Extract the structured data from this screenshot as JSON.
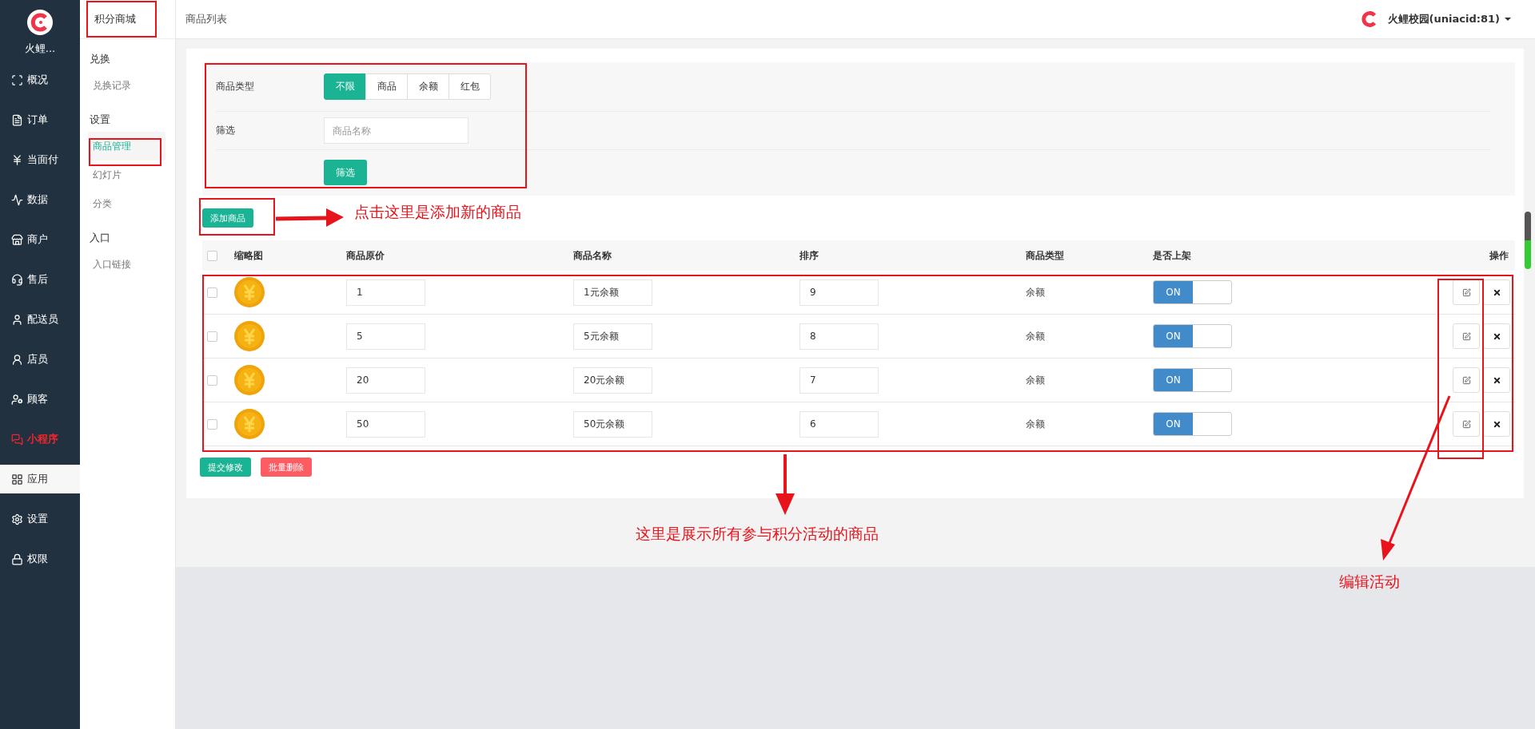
{
  "brand": {
    "name": "火鲤..."
  },
  "nav": [
    {
      "label": "概况",
      "selected": false,
      "highlight": false
    },
    {
      "label": "订单",
      "selected": false,
      "highlight": false
    },
    {
      "label": "当面付",
      "selected": false,
      "highlight": false
    },
    {
      "label": "数据",
      "selected": false,
      "highlight": false
    },
    {
      "label": "商户",
      "selected": false,
      "highlight": false
    },
    {
      "label": "售后",
      "selected": false,
      "highlight": false
    },
    {
      "label": "配送员",
      "selected": false,
      "highlight": false
    },
    {
      "label": "店员",
      "selected": false,
      "highlight": false
    },
    {
      "label": "顾客",
      "selected": false,
      "highlight": false
    },
    {
      "label": "小程序",
      "selected": false,
      "highlight": true
    },
    {
      "label": "应用",
      "selected": true,
      "highlight": false
    },
    {
      "label": "设置",
      "selected": false,
      "highlight": false
    },
    {
      "label": "权限",
      "selected": false,
      "highlight": false
    }
  ],
  "subnav": {
    "title": "积分商城",
    "groups": [
      {
        "label": "兑换",
        "items": [
          {
            "label": "兑换记录",
            "selected": false
          }
        ]
      },
      {
        "label": "设置",
        "items": [
          {
            "label": "商品管理",
            "selected": true
          },
          {
            "label": "幻灯片",
            "selected": false
          },
          {
            "label": "分类",
            "selected": false
          }
        ]
      },
      {
        "label": "入口",
        "items": [
          {
            "label": "入口链接",
            "selected": false
          }
        ]
      }
    ]
  },
  "header": {
    "title": "商品列表",
    "account": "火鲤校园(uniacid:81)"
  },
  "filter": {
    "type_label": "商品类型",
    "types": [
      {
        "label": "不限",
        "selected": true
      },
      {
        "label": "商品",
        "selected": false
      },
      {
        "label": "余额",
        "selected": false
      },
      {
        "label": "红包",
        "selected": false
      }
    ],
    "search_label": "筛选",
    "search_placeholder": "商品名称",
    "submit": "筛选"
  },
  "add_button": "添加商品",
  "table": {
    "all_checked": false,
    "columns": [
      "缩略图",
      "商品原价",
      "商品名称",
      "排序",
      "商品类型",
      "是否上架",
      "操作"
    ],
    "rows": [
      {
        "checked": false,
        "price": "1",
        "name": "1元余额",
        "sort": "9",
        "type": "余额",
        "on": true,
        "switch_label": "ON"
      },
      {
        "checked": false,
        "price": "5",
        "name": "5元余额",
        "sort": "8",
        "type": "余额",
        "on": true,
        "switch_label": "ON"
      },
      {
        "checked": false,
        "price": "20",
        "name": "20元余额",
        "sort": "7",
        "type": "余额",
        "on": true,
        "switch_label": "ON"
      },
      {
        "checked": false,
        "price": "50",
        "name": "50元余额",
        "sort": "6",
        "type": "余额",
        "on": true,
        "switch_label": "ON"
      }
    ]
  },
  "actions": [
    {
      "label": "提交修改",
      "kind": "primary"
    },
    {
      "label": "批量删除",
      "kind": "danger"
    }
  ],
  "annotations": [
    {
      "text": "点击这里是添加新的商品"
    },
    {
      "text": "这里是展示所有参与积分活动的商品"
    },
    {
      "text": "编辑活动"
    }
  ]
}
